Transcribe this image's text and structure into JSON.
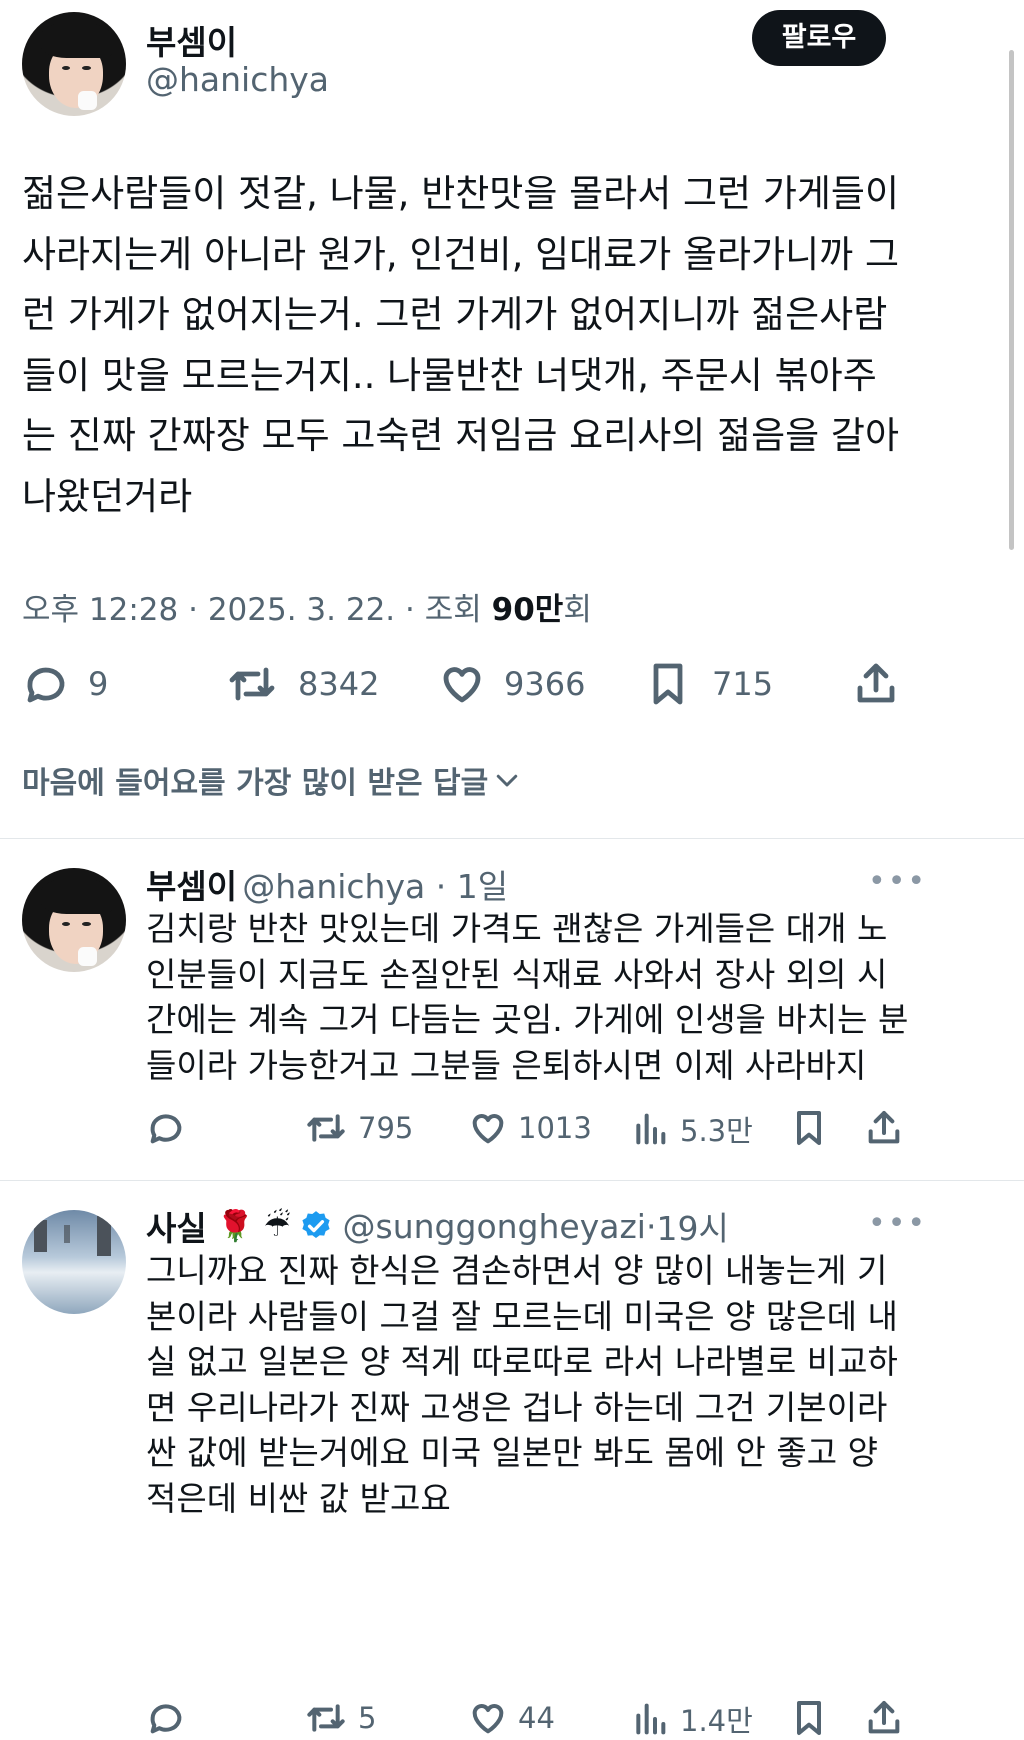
{
  "tweet": {
    "author_name": "부셈이",
    "author_handle": "@hanichya",
    "follow_label": "팔로우",
    "text": "젊은사람들이 젓갈, 나물, 반찬맛을 몰라서 그런 가게들이 사라지는게 아니라 원가, 인건비, 임대료가 올라가니까 그런 가게가 없어지는거. 그런 가게가 없어지니까 젊은사람들이 맛을 모르는거지.. 나물반찬 너댓개, 주문시 볶아주는 진짜 간짜장 모두 고숙련 저임금 요리사의 젊음을 갈아나왔던거라",
    "lines": [
      "젊은사람들이 젓갈, 나물, 반찬맛을 몰라서 그런 가게들이",
      "사라지는게 아니라 원가, 인건비, 임대료가 올라가니까 그",
      "런 가게가 없어지는거. 그런 가게가 없어지니까 젊은사람",
      "들이 맛을 모르는거지.. 나물반찬 너댓개, 주문시 볶아주",
      "는 진짜 간짜장 모두 고숙련 저임금 요리사의 젊음을 갈아",
      "나왔던거라"
    ],
    "time": "오후 12:28",
    "date": "2025. 3. 22.",
    "views_prefix": "조회",
    "views_count": "90만",
    "views_suffix": "회",
    "replies": "9",
    "retweets": "8342",
    "likes": "9366",
    "bookmarks": "715"
  },
  "sort_label": "마음에 들어요를 가장 많이 받은 답글",
  "replies": [
    {
      "author_name": "부셈이",
      "author_handle": "@hanichya",
      "age": "1일",
      "lines": [
        "김치랑 반찬 맛있는데 가격도 괜찮은 가게들은 대개 노",
        "인분들이 지금도 손질안된 식재료 사와서 장사 외의 시",
        "간에는 계속 그거 다듬는 곳임. 가게에 인생을 바치는 분",
        "들이라 가능한거고 그분들 은퇴하시면 이제 사라바지"
      ],
      "retweets": "795",
      "likes": "1013",
      "views": "5.3만"
    },
    {
      "author_name": "사실",
      "name_emojis": "🌹 ☔",
      "author_handle": "@sunggongheyazi",
      "age": "19시",
      "lines": [
        "그니까요 진짜 한식은 겸손하면서 양 많이 내놓는게 기",
        "본이라 사람들이 그걸 잘 모르는데 미국은 양 많은데 내",
        "실 없고 일본은 양 적게 따로따로 라서 나라별로 비교하",
        "면 우리나라가 진짜 고생은 겁나 하는데 그건 기본이라",
        "싼 값에 받는거에요 미국 일본만 봐도 몸에 안 좋고 양",
        "적은데 비싼 값 받고요"
      ],
      "retweets": "5",
      "likes": "44",
      "views": "1.4만"
    }
  ],
  "icons": [
    "reply-icon",
    "retweet-icon",
    "like-icon",
    "bookmark-icon",
    "share-icon",
    "views-icon",
    "verified-badge-icon",
    "more-icon",
    "chevron-down-icon"
  ],
  "colors": {
    "text": "#0f1419",
    "secondary": "#536471",
    "verified": "#1d9bf0",
    "divider": "#e3e7ea"
  }
}
